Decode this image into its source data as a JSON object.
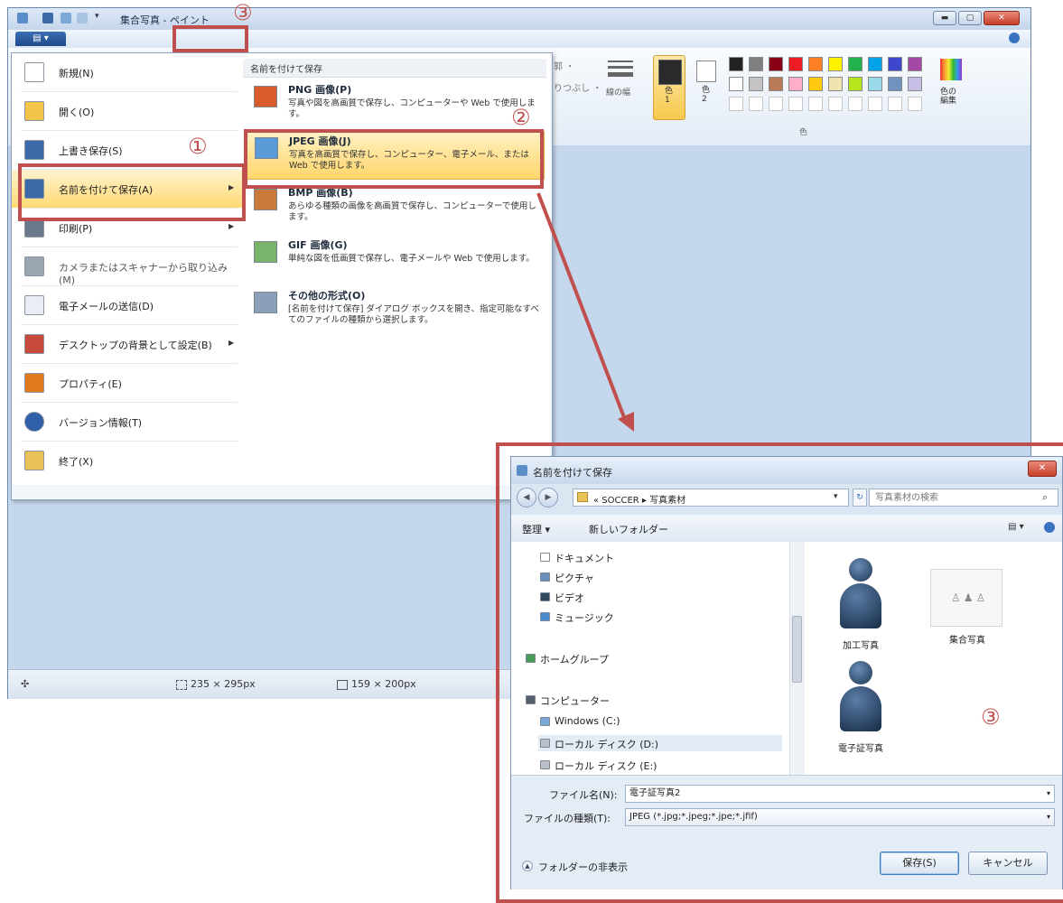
{
  "paint": {
    "title": "集合写真 - ペイント",
    "ribbon": {
      "line_width_label": "線の幅",
      "color1_label": "色\n1",
      "color2_label": "色\n2",
      "edit_colors_label": "色の\n編集",
      "colors_group_label": "色",
      "partial_label_1": "郭 ・",
      "partial_label_2": "りつぶし ・",
      "palette_row1": [
        "#222222",
        "#7f7f7f",
        "#880015",
        "#ed1c24",
        "#ff7f27",
        "#fff200",
        "#22b14c",
        "#00a2e8",
        "#3f48cc",
        "#a349a4"
      ],
      "palette_row2": [
        "#ffffff",
        "#c3c3c3",
        "#b97a57",
        "#ffaec9",
        "#ffc90e",
        "#efe4b0",
        "#b5e61d",
        "#99d9ea",
        "#7092be",
        "#c8bfe7"
      ]
    },
    "status": {
      "move_glyph": "✣",
      "selection_size": "235 × 295px",
      "image_size": "159 × 200px"
    }
  },
  "file_menu": {
    "items": [
      {
        "label": "新規(N)",
        "icon": "new-document-icon"
      },
      {
        "label": "開く(O)",
        "icon": "open-folder-icon"
      },
      {
        "label": "上書き保存(S)",
        "icon": "save-disk-icon"
      },
      {
        "label": "名前を付けて保存(A)",
        "icon": "save-as-icon",
        "submenu": true
      },
      {
        "label": "印刷(P)",
        "icon": "printer-icon",
        "submenu": true
      },
      {
        "label": "カメラまたはスキャナーから取り込み(M)",
        "icon": "scanner-icon"
      },
      {
        "label": "電子メールの送信(D)",
        "icon": "email-icon"
      },
      {
        "label": "デスクトップの背景として設定(B)",
        "icon": "desktop-background-icon",
        "submenu": true
      },
      {
        "label": "プロパティ(E)",
        "icon": "checkmark-icon"
      },
      {
        "label": "バージョン情報(T)",
        "icon": "info-icon"
      },
      {
        "label": "終了(X)",
        "icon": "exit-icon"
      }
    ],
    "submenu_header": "名前を付けて保存",
    "submenu": [
      {
        "title": "PNG 画像(P)",
        "desc": "写真や図を高画質で保存し、コンピューターや Web で使用します。"
      },
      {
        "title": "JPEG 画像(J)",
        "desc": "写真を高画質で保存し、コンピューター、電子メール、または Web で使用します。"
      },
      {
        "title": "BMP 画像(B)",
        "desc": "あらゆる種類の画像を高画質で保存し、コンピューターで使用します。"
      },
      {
        "title": "GIF 画像(G)",
        "desc": "単純な図を低画質で保存し、電子メールや Web で使用します。"
      },
      {
        "title": "その他の形式(O)",
        "desc": "[名前を付けて保存] ダイアログ ボックスを開き、指定可能なすべてのファイルの種類から選択します。"
      }
    ]
  },
  "dialog": {
    "title": "名前を付けて保存",
    "close_glyph": "✕",
    "breadcrumb": "« SOCCER ▸ 写真素材",
    "search_placeholder": "写真素材の検索",
    "organize_label": "整理 ▾",
    "new_folder_label": "新しいフォルダー",
    "nav_items": [
      {
        "label": "ドキュメント"
      },
      {
        "label": "ピクチャ"
      },
      {
        "label": "ビデオ"
      },
      {
        "label": "ミュージック"
      },
      {
        "label": "ホームグループ"
      },
      {
        "label": "コンピューター"
      },
      {
        "label": "Windows (C:)"
      },
      {
        "label": "ローカル ディスク (D:)"
      },
      {
        "label": "ローカル ディスク (E:)"
      }
    ],
    "files": [
      {
        "name": "加工写真"
      },
      {
        "name": "集合写真"
      },
      {
        "name": "電子証写真"
      }
    ],
    "filename_label": "ファイル名(N):",
    "filename_value": "電子証写真2",
    "filetype_label": "ファイルの種類(T):",
    "filetype_value": "JPEG (*.jpg;*.jpeg;*.jpe;*.jfif)",
    "hide_folders_label": "フォルダーの非表示",
    "save_button": "保存(S)",
    "cancel_button": "キャンセル"
  },
  "annotations": {
    "step1": "①",
    "step2": "②",
    "step3": "③",
    "accent": "#c0504d"
  }
}
